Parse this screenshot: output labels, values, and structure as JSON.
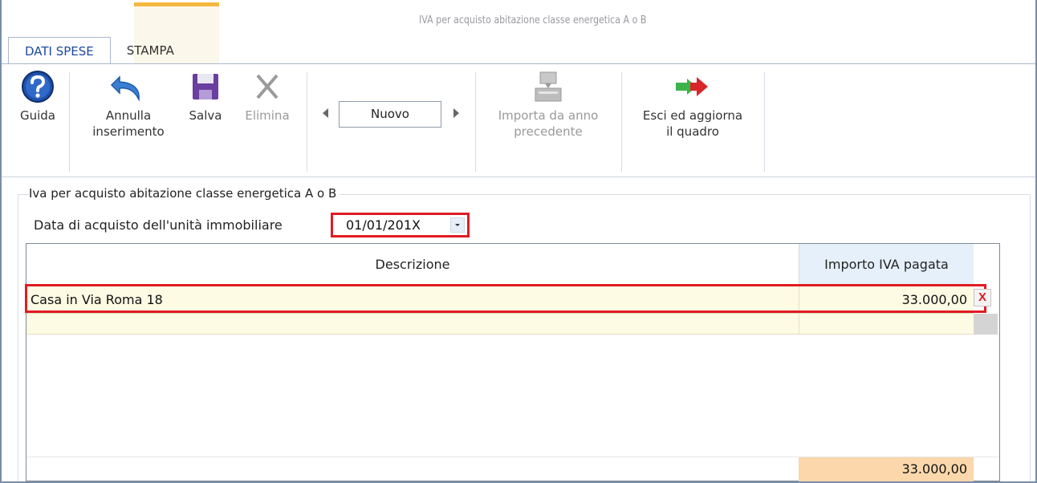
{
  "window": {
    "title": "IVA per acquisto abitazione classe energetica A o B"
  },
  "tabs": [
    {
      "label": "DATI SPESE",
      "active": true
    },
    {
      "label": "STAMPA",
      "active": false
    }
  ],
  "ribbon": {
    "guida": {
      "label": "Guida",
      "icon": "help-icon"
    },
    "annulla": {
      "label_line1": "Annulla",
      "label_line2": "inserimento",
      "icon": "undo-icon"
    },
    "salva": {
      "label": "Salva",
      "icon": "save-icon"
    },
    "elimina": {
      "label": "Elimina",
      "icon": "delete-icon",
      "disabled": true
    },
    "navigator": {
      "value": "Nuovo"
    },
    "importa": {
      "label_line1": "Importa da anno",
      "label_line2": "precedente",
      "icon": "import-icon",
      "disabled": true
    },
    "esci": {
      "label_line1": "Esci ed aggiorna",
      "label_line2": "il quadro",
      "icon": "exit-update-icon"
    }
  },
  "group": {
    "legend": "Iva per acquisto abitazione classe energetica A o B",
    "date_label": "Data di acquisto dell'unità immobiliare",
    "date_value": "01/01/201X"
  },
  "grid": {
    "columns": {
      "descrizione": "Descrizione",
      "importo": "Importo IVA pagata"
    },
    "rows": [
      {
        "descrizione": "Casa in Via Roma 18",
        "importo": "33.000,00"
      }
    ],
    "delete_label": "X",
    "total": "33.000,00"
  },
  "colors": {
    "highlight": "#e11b22",
    "total_bg": "#fbd7ab",
    "row_bg": "#fdfbe3",
    "accent": "#f5b840"
  }
}
